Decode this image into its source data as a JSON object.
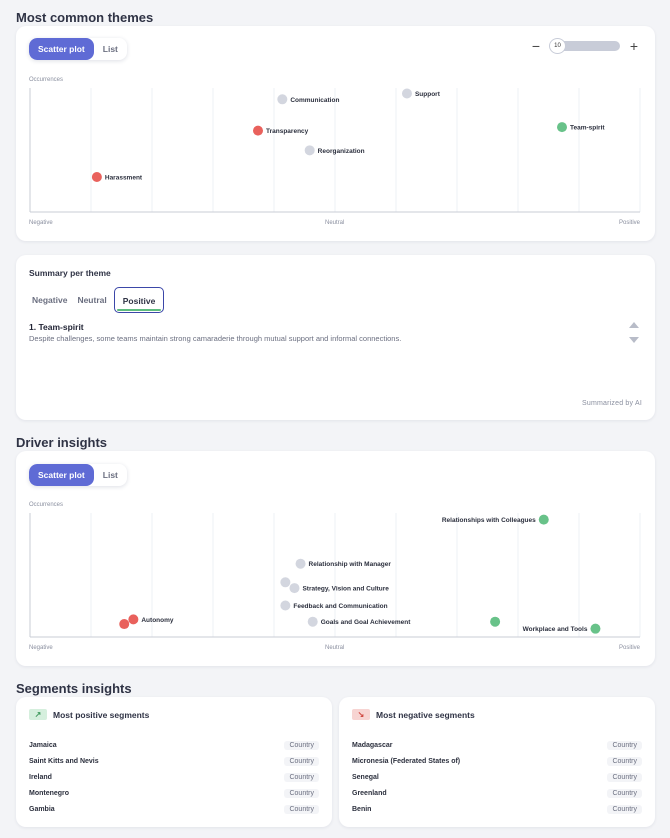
{
  "themes_section": {
    "title": "Most common themes",
    "toggle": {
      "scatter": "Scatter plot",
      "list": "List"
    },
    "zoom": {
      "minus": "−",
      "value": "10",
      "plus": "+"
    },
    "y_label": "Occurrences",
    "x_labels": {
      "left": "Negative",
      "center": "Neutral",
      "right": "Positive"
    }
  },
  "summary_section": {
    "title": "Summary per theme",
    "tabs": [
      "Negative",
      "Neutral",
      "Positive"
    ],
    "active_tab": "Positive",
    "item_title": "1. Team-spirit",
    "item_text": "Despite challenges, some teams maintain strong camaraderie through mutual support and informal connections.",
    "footer": "Summarized by AI"
  },
  "drivers_section": {
    "title": "Driver insights",
    "toggle": {
      "scatter": "Scatter plot",
      "list": "List"
    },
    "y_label": "Occurrences",
    "x_labels": {
      "left": "Negative",
      "center": "Neutral",
      "right": "Positive"
    }
  },
  "segments_section": {
    "title": "Segments insights",
    "positive": {
      "title": "Most positive segments",
      "icon": "trend-up-icon",
      "rows": [
        {
          "name": "Jamaica",
          "type": "Country"
        },
        {
          "name": "Saint Kitts and Nevis",
          "type": "Country"
        },
        {
          "name": "Ireland",
          "type": "Country"
        },
        {
          "name": "Montenegro",
          "type": "Country"
        },
        {
          "name": "Gambia",
          "type": "Country"
        }
      ]
    },
    "negative": {
      "title": "Most negative segments",
      "icon": "trend-down-icon",
      "rows": [
        {
          "name": "Madagascar",
          "type": "Country"
        },
        {
          "name": "Micronesia (Federated States of)",
          "type": "Country"
        },
        {
          "name": "Senegal",
          "type": "Country"
        },
        {
          "name": "Greenland",
          "type": "Country"
        },
        {
          "name": "Benin",
          "type": "Country"
        }
      ]
    }
  },
  "colors": {
    "negative": "#e9615c",
    "neutral": "#d3d6df",
    "positive": "#68c289",
    "accent": "#5f6bd5"
  },
  "chart_data": [
    {
      "type": "scatter",
      "name": "themes",
      "xlabel": "",
      "ylabel": "Occurrences",
      "xlim": [
        -1,
        1
      ],
      "ylim": [
        0,
        100
      ],
      "points": [
        {
          "label": "Communication",
          "x": -0.17,
          "y": 92,
          "sentiment": "neutral"
        },
        {
          "label": "Support",
          "x": 0.24,
          "y": 97,
          "sentiment": "neutral"
        },
        {
          "label": "Transparency",
          "x": -0.25,
          "y": 65,
          "sentiment": "negative"
        },
        {
          "label": "Team-spirit",
          "x": 0.75,
          "y": 68,
          "sentiment": "positive"
        },
        {
          "label": "Reorganization",
          "x": -0.08,
          "y": 48,
          "sentiment": "neutral"
        },
        {
          "label": "Harassment",
          "x": -0.78,
          "y": 25,
          "sentiment": "negative"
        }
      ]
    },
    {
      "type": "scatter",
      "name": "drivers",
      "xlabel": "",
      "ylabel": "Occurrences",
      "xlim": [
        -1,
        1
      ],
      "ylim": [
        0,
        100
      ],
      "points": [
        {
          "label": "Relationships with Colleagues",
          "x": 0.69,
          "y": 96,
          "sentiment": "positive",
          "label_side": "left"
        },
        {
          "label": "Relationship with Manager",
          "x": -0.11,
          "y": 58,
          "sentiment": "neutral"
        },
        {
          "label": "",
          "x": -0.16,
          "y": 42,
          "sentiment": "neutral"
        },
        {
          "label": "Strategy, Vision and Culture",
          "x": -0.13,
          "y": 37,
          "sentiment": "neutral"
        },
        {
          "label": "Feedback and Communication",
          "x": -0.16,
          "y": 22,
          "sentiment": "neutral"
        },
        {
          "label": "Autonomy",
          "x": -0.66,
          "y": 10,
          "sentiment": "negative"
        },
        {
          "label": "",
          "x": -0.69,
          "y": 6,
          "sentiment": "negative"
        },
        {
          "label": "Goals and Goal Achievement",
          "x": -0.07,
          "y": 8,
          "sentiment": "neutral"
        },
        {
          "label": "",
          "x": 0.53,
          "y": 8,
          "sentiment": "positive"
        },
        {
          "label": "Workplace and Tools",
          "x": 0.86,
          "y": 2,
          "sentiment": "positive",
          "label_side": "left"
        }
      ]
    }
  ]
}
